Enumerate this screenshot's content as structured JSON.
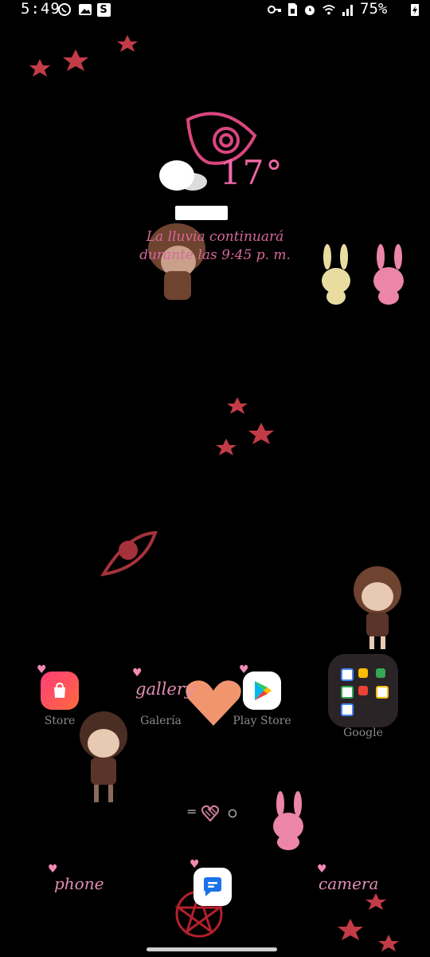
{
  "status_bar": {
    "time": "5:49",
    "status_app_letter": "S",
    "battery_percent": "75%"
  },
  "weather": {
    "temperature": "17°",
    "forecast_line1": "La lluvia continuará",
    "forecast_line2": "durante las 9:45 p. m."
  },
  "apps": {
    "store_label": "Store",
    "gallery_label": "Galería",
    "gallery_handwriting": "gallery",
    "playstore_label": "Play Store",
    "google_label": "Google"
  },
  "dock": {
    "phone_label": "phone",
    "camera_label": "camera"
  },
  "page_indicator": {
    "symbol": "="
  },
  "colors": {
    "background": "#000000",
    "accent_pink": "#f067a8",
    "decor_red": "#c9434e",
    "label_gray": "#8a8a8a"
  }
}
